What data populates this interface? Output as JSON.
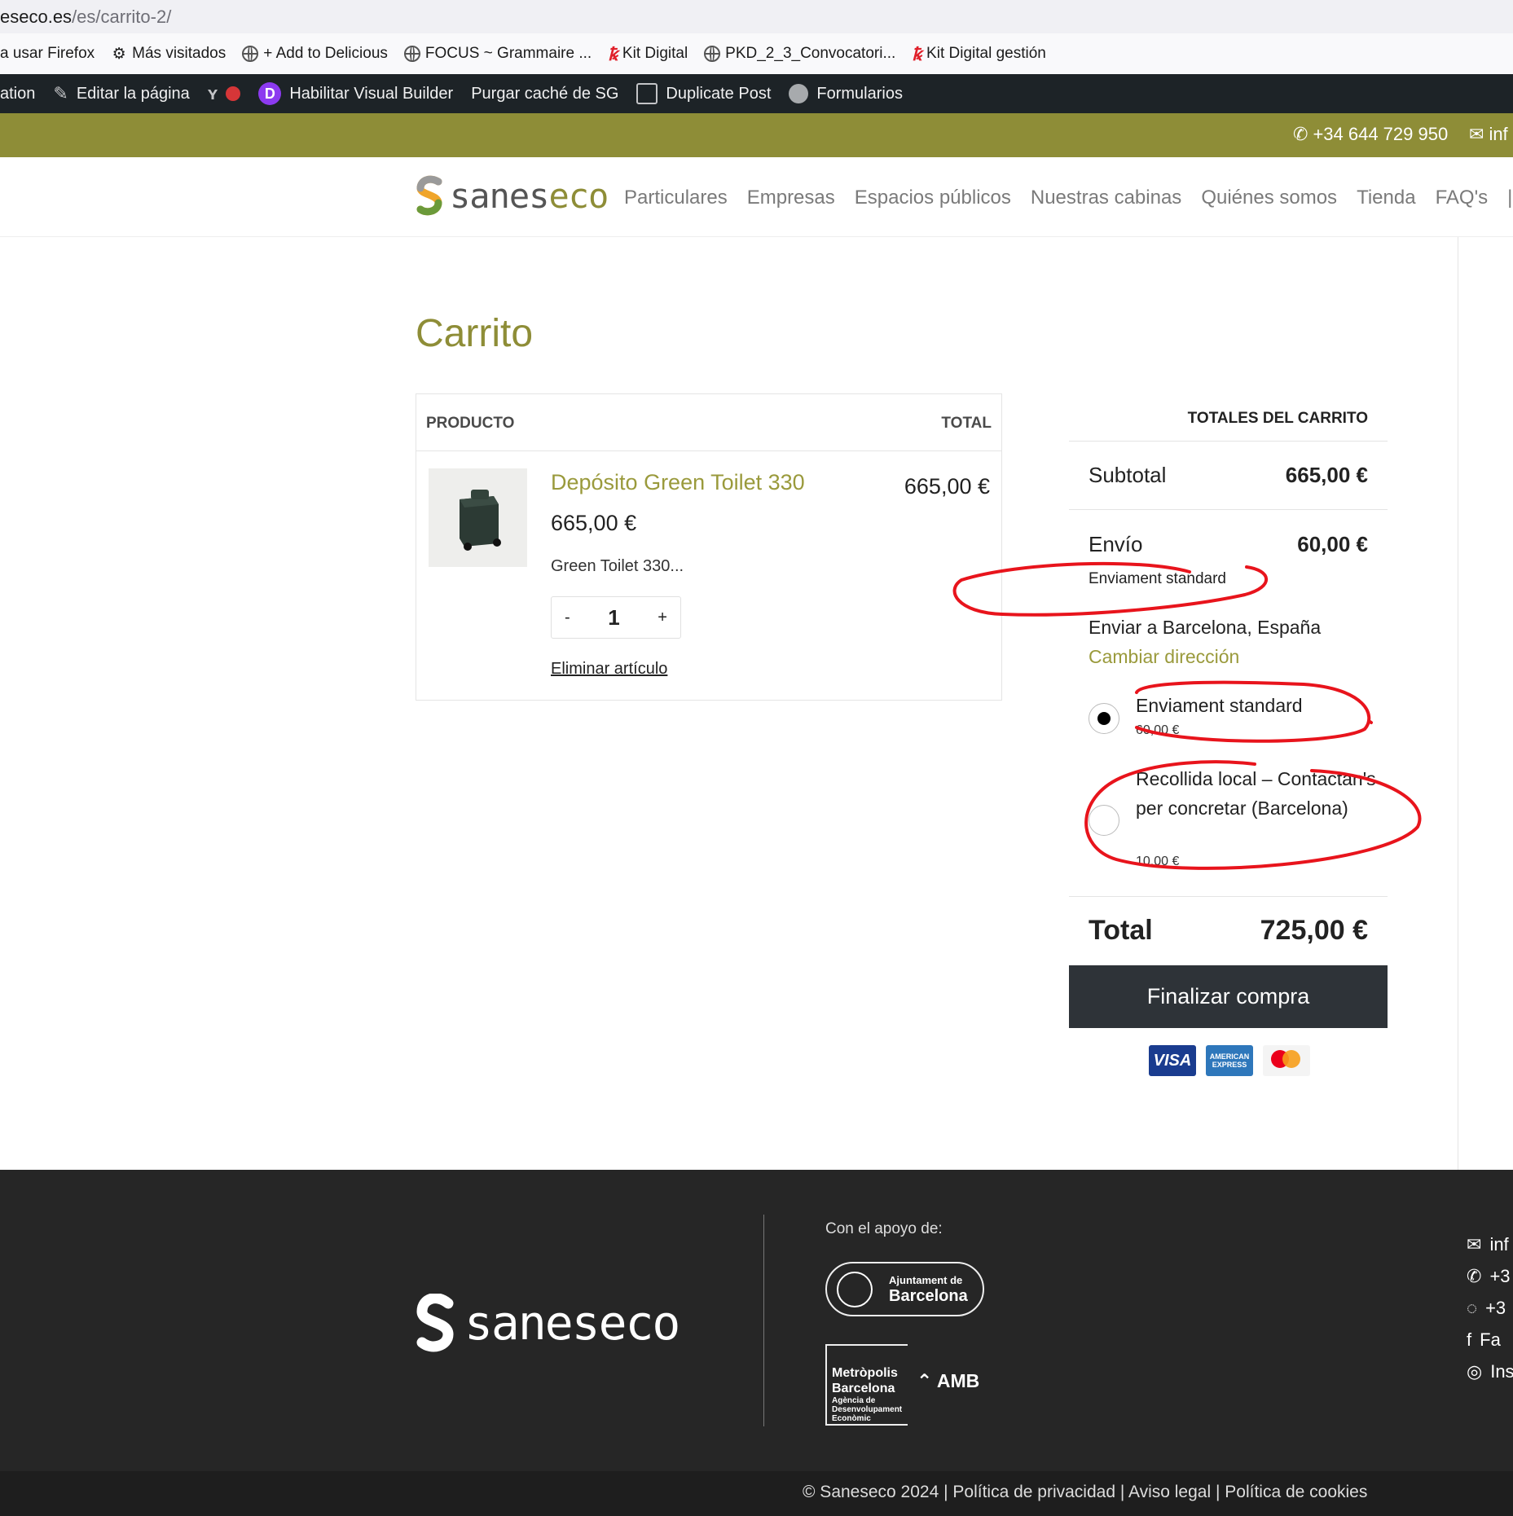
{
  "browser": {
    "url_domain": "eseco.es",
    "url_path": "/es/carrito-2/",
    "bookmarks": [
      {
        "label": "a usar Firefox",
        "icon": "none"
      },
      {
        "label": "Más visitados",
        "icon": "gear-icon"
      },
      {
        "label": "+ Add to Delicious",
        "icon": "globe-icon"
      },
      {
        "label": "FOCUS ~ Grammaire ...",
        "icon": "globe-icon"
      },
      {
        "label": "Kit Digital",
        "icon": "kit-digital-icon"
      },
      {
        "label": "PKD_2_3_Convocatori...",
        "icon": "globe-icon"
      },
      {
        "label": "Kit Digital gestión",
        "icon": "kit-digital-icon"
      }
    ]
  },
  "adminbar": {
    "items": [
      "ation",
      "Editar la página",
      "Habilitar Visual Builder",
      "Purgar caché de SG",
      "Duplicate Post",
      "Formularios"
    ],
    "divi_letter": "D"
  },
  "topbar": {
    "phone": "+34 644 729 950",
    "email": "inf"
  },
  "header": {
    "logo_part1": "sanes",
    "logo_part2": "eco",
    "nav": [
      "Particulares",
      "Empresas",
      "Espacios públicos",
      "Nuestras cabinas",
      "Quiénes somos",
      "Tienda",
      "FAQ's",
      "|"
    ]
  },
  "cart": {
    "title": "Carrito",
    "col_product": "PRODUCTO",
    "col_total": "TOTAL",
    "item": {
      "name": "Depósito Green Toilet 330",
      "price": "665,00 €",
      "description": "Green Toilet 330...",
      "quantity": "1",
      "minus": "-",
      "plus": "+",
      "row_total": "665,00 €",
      "remove_label": "Eliminar artículo"
    }
  },
  "totals": {
    "title": "TOTALES DEL CARRITO",
    "subtotal_label": "Subtotal",
    "subtotal_value": "665,00 €",
    "shipping_label": "Envío",
    "shipping_value": "60,00 €",
    "shipping_method": "Enviament standard",
    "ship_to": "Enviar a Barcelona, España",
    "change_address": "Cambiar dirección",
    "options": [
      {
        "label": "Enviament standard",
        "price": "60,00 €",
        "selected": true
      },
      {
        "label": "Recollida local – Contactan's per concretar (Barcelona)",
        "price": "10,00 €",
        "selected": false
      }
    ],
    "total_label": "Total",
    "total_value": "725,00 €",
    "checkout_label": "Finalizar compra",
    "cards": [
      "VISA",
      "AMERICAN EXPRESS",
      "mastercard"
    ]
  },
  "footer": {
    "logo_text": "saneseco",
    "support_label": "Con el apoyo de:",
    "ajuntament_line1": "Ajuntament de",
    "ajuntament_line2": "Barcelona",
    "metropolis_lines": [
      "Metròpolis",
      "Barcelona"
    ],
    "metropolis_sub": [
      "Agència de",
      "Desenvolupament",
      "Econòmic"
    ],
    "amb_label": "AMB",
    "contacts": [
      "inf",
      "+3",
      "+3",
      "Fa",
      "Ins"
    ],
    "copyright": "© Saneseco 2024 | Política de privacidad | Aviso legal | Política de cookies"
  },
  "colors": {
    "olive": "#8e8d37",
    "admin_bar": "#1d2327",
    "checkout_button": "#2e3338",
    "footer_bg": "#262626",
    "annotation_red": "#e8141c"
  }
}
